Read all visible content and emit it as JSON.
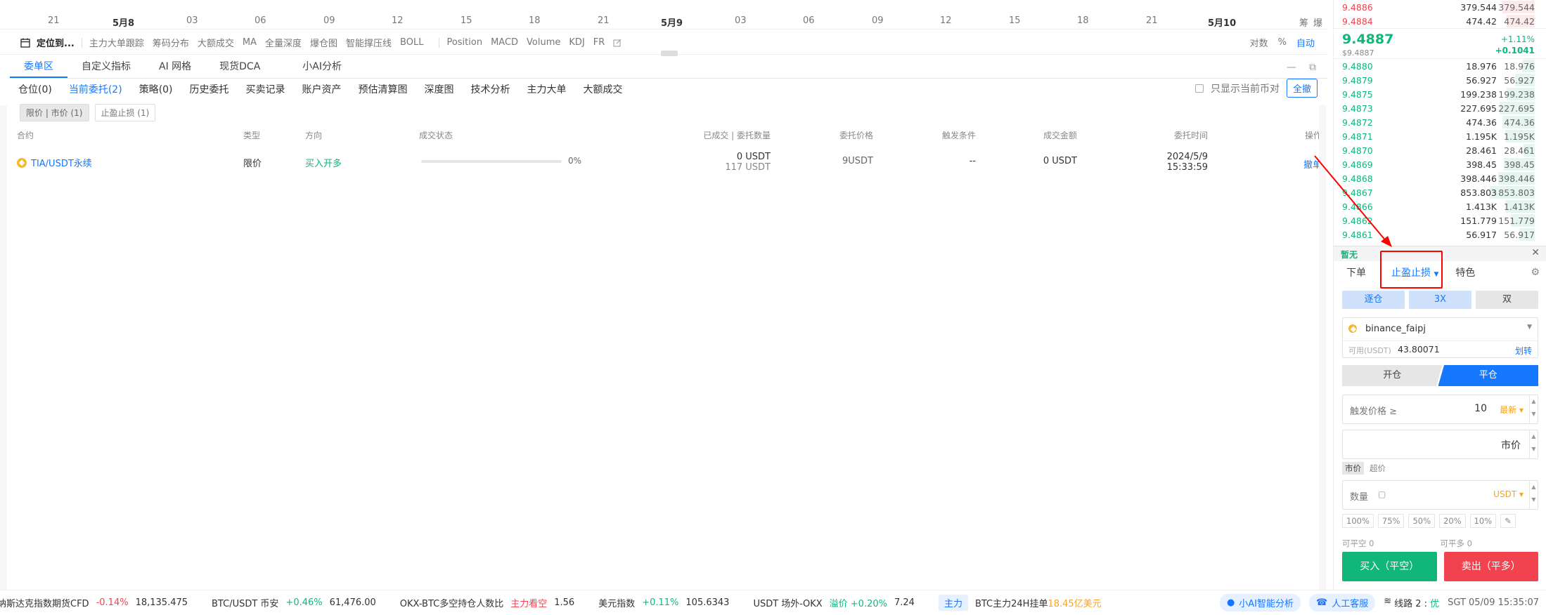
{
  "time_axis": {
    "labels": [
      "21",
      "5月8",
      "03",
      "06",
      "09",
      "12",
      "15",
      "18",
      "21",
      "5月9",
      "03",
      "06",
      "09",
      "12",
      "15",
      "18",
      "21",
      "5月10"
    ],
    "extra": [
      "筹",
      "爆"
    ]
  },
  "indicator_bar": {
    "locate": "定位到...",
    "items": [
      "主力大单跟踪",
      "筹码分布",
      "大额成交",
      "MA",
      "全量深度",
      "爆仓图",
      "智能撑压线",
      "BOLL"
    ],
    "items2": [
      "Position",
      "MACD",
      "Volume",
      "KDJ",
      "FR"
    ],
    "right": [
      "对数",
      "%",
      "自动"
    ]
  },
  "panel_tabs": [
    "委单区",
    "自定义指标",
    "AI 网格",
    "现货DCA",
    "小AI分析"
  ],
  "order_tabs": [
    {
      "label": "仓位",
      "count": "(0)"
    },
    {
      "label": "当前委托",
      "count": "(2)"
    },
    {
      "label": "策略",
      "count": "(0)"
    },
    {
      "label": "历史委托",
      "count": ""
    },
    {
      "label": "买卖记录",
      "count": ""
    },
    {
      "label": "账户资产",
      "count": ""
    },
    {
      "label": "预估清算图",
      "count": ""
    },
    {
      "label": "深度图",
      "count": ""
    },
    {
      "label": "技术分析",
      "count": ""
    },
    {
      "label": "主力大单",
      "count": ""
    },
    {
      "label": "大额成交",
      "count": ""
    }
  ],
  "only_current": "只显示当前币对",
  "cancel_all": "全撤",
  "sub_tabs": [
    "限价 | 市价 (1)",
    "止盈止损 (1)"
  ],
  "table": {
    "headers": [
      "合约",
      "类型",
      "方向",
      "成交状态",
      "已成交 | 委托数量",
      "委托价格",
      "触发条件",
      "成交金额",
      "委托时间",
      "操作"
    ],
    "rows": [
      {
        "contract": "TIA/USDT永续",
        "type": "限价",
        "direction": "买入开多",
        "pct": "0%",
        "filled": "0 USDT",
        "qty": "117 USDT",
        "price": "9USDT",
        "trigger": "--",
        "amount": "0 USDT",
        "date": "2024/5/9",
        "time": "15:33:59",
        "action": "撤单"
      }
    ]
  },
  "orderbook": {
    "top": [
      {
        "p": "9.4886",
        "a": "379.544",
        "t": "379.544"
      },
      {
        "p": "9.4884",
        "a": "474.42",
        "t": "474.42"
      }
    ],
    "mid_price": "9.4887",
    "mid_usd": "$9.4887",
    "change_pct": "+1.11%",
    "change_abs": "+0.1041",
    "bids": [
      {
        "p": "9.4880",
        "a": "18.976",
        "t": "18.976"
      },
      {
        "p": "9.4879",
        "a": "56.927",
        "t": "56.927"
      },
      {
        "p": "9.4875",
        "a": "199.238",
        "t": "199.238"
      },
      {
        "p": "9.4873",
        "a": "227.695",
        "t": "227.695"
      },
      {
        "p": "9.4872",
        "a": "474.36",
        "t": "474.36"
      },
      {
        "p": "9.4871",
        "a": "1.195K",
        "t": "1.195K"
      },
      {
        "p": "9.4870",
        "a": "28.461",
        "t": "28.461"
      },
      {
        "p": "9.4869",
        "a": "398.45",
        "t": "398.45"
      },
      {
        "p": "9.4868",
        "a": "398.446",
        "t": "398.446"
      },
      {
        "p": "9.4867",
        "a": "853.803",
        "t": "853.803"
      },
      {
        "p": "9.4866",
        "a": "1.413K",
        "t": "1.413K"
      },
      {
        "p": "9.4862",
        "a": "151.779",
        "t": "151.779"
      },
      {
        "p": "9.4861",
        "a": "56.917",
        "t": "56.917"
      }
    ]
  },
  "trade_panel": {
    "none": "暂无",
    "tabs": [
      "下单",
      "止盈止损",
      "特色"
    ],
    "margin": [
      "逐仓",
      "3X",
      "双"
    ],
    "account": "binance_faipj",
    "avail_label": "可用(USDT)",
    "avail": "43.80071",
    "transfer": "划转",
    "open": "开仓",
    "close": "平仓",
    "trigger_label": "触发价格 ≥",
    "trigger_value": "10",
    "latest": "最新",
    "market": "市价",
    "price_types": [
      "市价",
      "超价"
    ],
    "qty_label": "数量",
    "qty_unit": "USDT",
    "pcts": [
      "100%",
      "75%",
      "50%",
      "20%",
      "10%"
    ],
    "can_close_short": "可平空 0",
    "can_close_long": "可平多 0",
    "buy": "买入（平空）",
    "sell": "卖出（平多）"
  },
  "status_bar": {
    "items": [
      {
        "name": "纳斯达克指数期货CFD",
        "chg": "-0.14%",
        "val": "18,135.475"
      },
      {
        "name": "BTC/USDT 币安",
        "chg": "+0.46%",
        "val": "61,476.00"
      },
      {
        "name": "OKX-BTC多空持仓人数比",
        "chg": "主力看空",
        "val": "1.56"
      },
      {
        "name": "美元指数",
        "chg": "+0.11%",
        "val": "105.6343"
      },
      {
        "name": "USDT 场外-OKX",
        "chg": "溢价 +0.20%",
        "val": "7.24"
      }
    ],
    "tag": "主力",
    "tag_text": "BTC主力24H挂单",
    "tag_val": "18.45亿美元",
    "ai": "小AI智能分析",
    "service": "人工客服",
    "line": "线路 2 :",
    "line_q": "优",
    "clock": "SGT  05/09 15:35:07"
  },
  "colors": {
    "accent": "#1677ff",
    "up": "#10b67a",
    "down": "#f0424f",
    "orange": "#f5a623"
  }
}
